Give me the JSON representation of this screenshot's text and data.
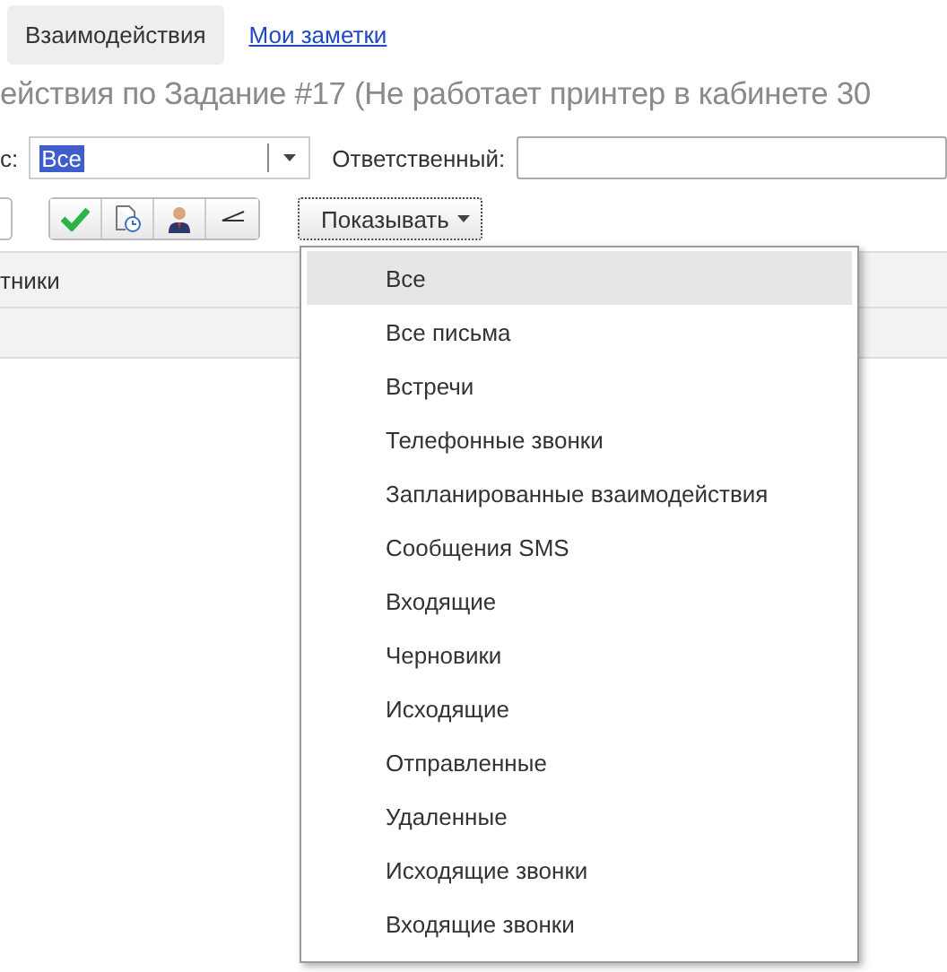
{
  "tabs": [
    {
      "label": "Взаимодействия",
      "selected": true
    },
    {
      "label": "Мои заметки",
      "selected": false
    }
  ],
  "title": "ействия по Задание #17 (Не работает принтер в кабинете 30",
  "filter": {
    "label": "с:",
    "value": "Все",
    "responsible_label": "Ответственный:"
  },
  "show_button": {
    "label": "Показывать"
  },
  "table": {
    "columns": [
      "тники"
    ]
  },
  "menu": [
    {
      "label": "Все",
      "selected": true
    },
    {
      "label": "Все письма",
      "selected": false
    },
    {
      "label": "Встречи",
      "selected": false
    },
    {
      "label": "Телефонные звонки",
      "selected": false
    },
    {
      "label": "Запланированные взаимодействия",
      "selected": false
    },
    {
      "label": "Сообщения SMS",
      "selected": false
    },
    {
      "label": "Входящие",
      "selected": false
    },
    {
      "label": "Черновики",
      "selected": false
    },
    {
      "label": "Исходящие",
      "selected": false
    },
    {
      "label": "Отправленные",
      "selected": false
    },
    {
      "label": "Удаленные",
      "selected": false
    },
    {
      "label": "Исходящие звонки",
      "selected": false
    },
    {
      "label": "Входящие звонки",
      "selected": false
    }
  ]
}
